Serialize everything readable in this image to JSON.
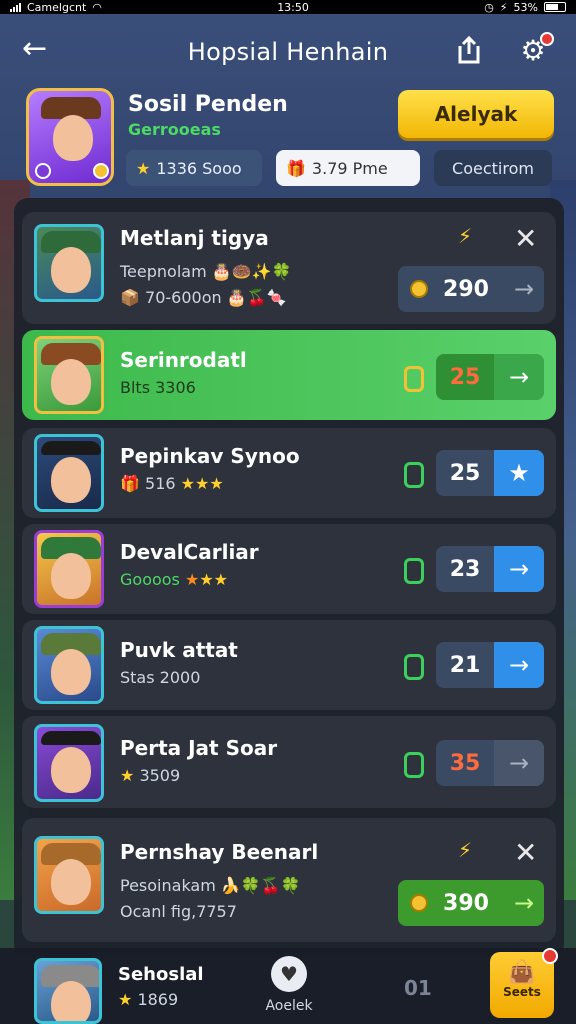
{
  "status_bar": {
    "carrier": "Camelgcnt",
    "time": "13:50",
    "battery": "53%"
  },
  "header": {
    "title": "Hopsial Henhain"
  },
  "profile": {
    "name": "Sosil Penden",
    "rank": "Gerrooeas",
    "primary_button": "Alelyak",
    "stat_a": "1336 Sooo",
    "stat_b": "3.79 Pme",
    "stat_c": "Coectirom"
  },
  "rows": [
    {
      "name": "Metlanj tigya",
      "sub": "Teepnolam",
      "sub2": "70-600on",
      "score": "290",
      "variant": "gray-big"
    },
    {
      "name": "Serinrodatl",
      "sub": "Blts 3306",
      "score": "25",
      "variant": "highlight"
    },
    {
      "name": "Pepinkav Synoo",
      "sub": "516",
      "score": "25",
      "variant": "blue"
    },
    {
      "name": "DevalCarliar",
      "sub": "Goooos",
      "score": "23",
      "variant": "blue"
    },
    {
      "name": "Puvk attat",
      "sub": "Stas 2000",
      "score": "21",
      "variant": "blue"
    },
    {
      "name": "Perta Jat Soar",
      "sub": "3509",
      "score": "35",
      "variant": "gray"
    },
    {
      "name": "Pernshay Beenarl",
      "sub": "Pesoinakam",
      "sub2": "Ocanl fig,7757",
      "score": "390",
      "variant": "green-big"
    }
  ],
  "bottom": {
    "name": "Sehoslal",
    "sub": "1869",
    "center_label": "Aoelek",
    "score": "01",
    "button_label": "Seets"
  },
  "colors": {
    "accent_yellow": "#f2b705",
    "highlight_green": "#3db94b",
    "blue_arrow": "#2f8fe9"
  }
}
